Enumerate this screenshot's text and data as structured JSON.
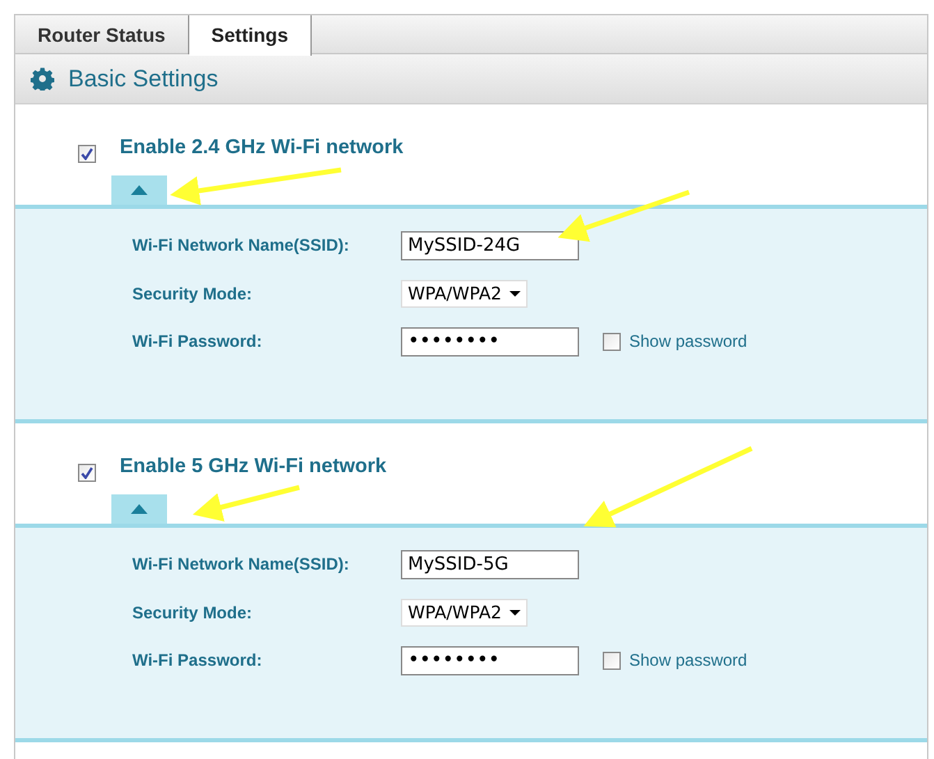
{
  "tabs": [
    {
      "label": "Router Status",
      "selected": false
    },
    {
      "label": "Settings",
      "selected": true
    }
  ],
  "header": {
    "title": "Basic Settings"
  },
  "networks": [
    {
      "title": "Enable 2.4 GHz Wi-Fi network",
      "enabled": true,
      "expanded": true,
      "ssid_label": "Wi-Fi Network Name(SSID):",
      "ssid": "MySSID-24G",
      "security_label": "Security Mode:",
      "security": "WPA/WPA2",
      "password_label": "Wi-Fi Password:",
      "password": "••••••••",
      "show_password_label": "Show password",
      "show_password": false
    },
    {
      "title": "Enable 5 GHz Wi-Fi network",
      "enabled": true,
      "expanded": true,
      "ssid_label": "Wi-Fi Network Name(SSID):",
      "ssid": "MySSID-5G",
      "security_label": "Security Mode:",
      "security": "WPA/WPA2",
      "password_label": "Wi-Fi Password:",
      "password": "••••••••",
      "show_password_label": "Show password",
      "show_password": false
    }
  ]
}
